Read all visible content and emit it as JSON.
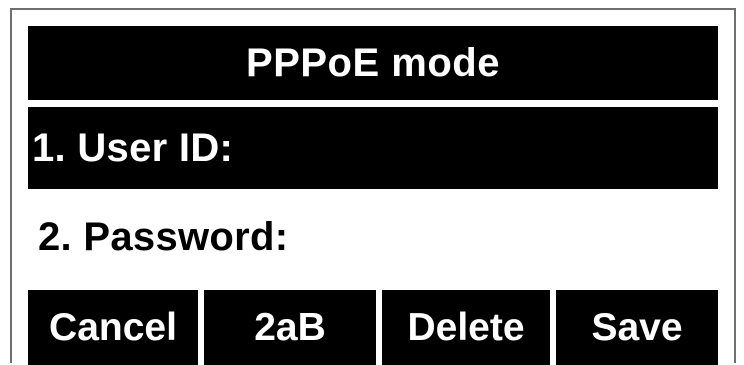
{
  "screen": {
    "title": "PPPoE mode",
    "items": [
      {
        "label": "1. User ID:",
        "selected": true
      },
      {
        "label": "2. Password:",
        "selected": false
      }
    ],
    "softkeys": [
      {
        "label": "Cancel"
      },
      {
        "label": "2aB"
      },
      {
        "label": "Delete"
      },
      {
        "label": "Save"
      }
    ]
  },
  "colors": {
    "background": "#ffffff",
    "highlight": "#000000",
    "highlight_text": "#ffffff",
    "frame": "#6f6f6f"
  }
}
